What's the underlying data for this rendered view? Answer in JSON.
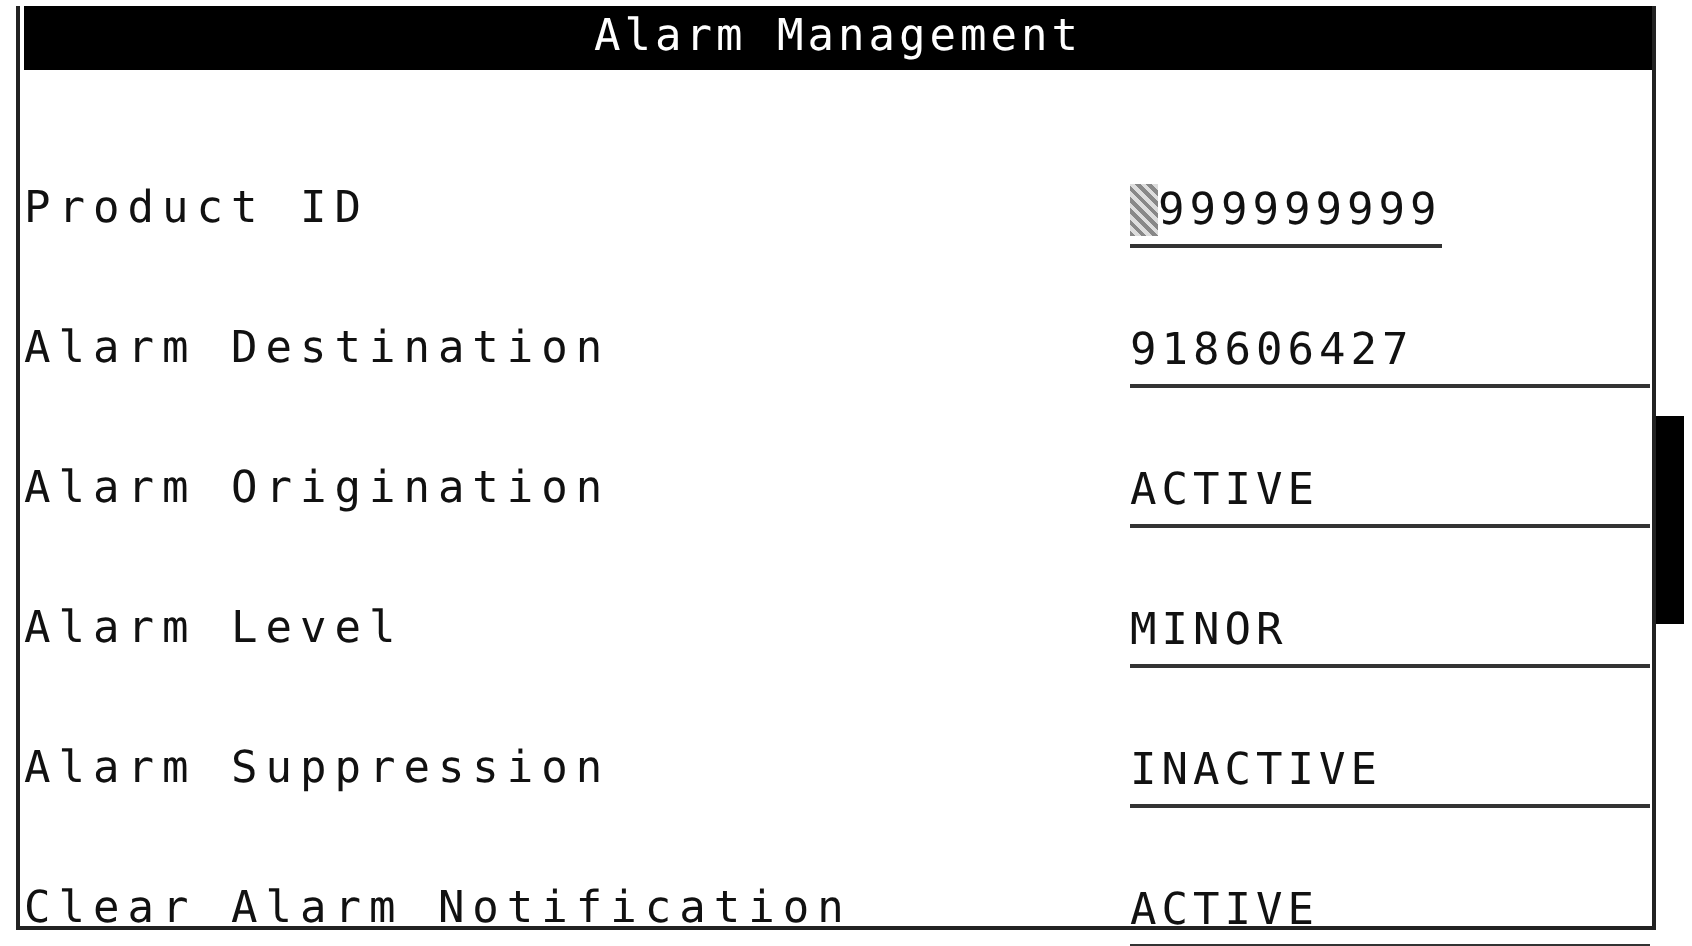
{
  "window": {
    "title": "Alarm Management"
  },
  "fields": [
    {
      "label": "Product ID",
      "value": "999999999",
      "focused": true
    },
    {
      "label": "Alarm Destination",
      "value": "918606427",
      "focused": false
    },
    {
      "label": "Alarm Origination",
      "value": "ACTIVE",
      "focused": false
    },
    {
      "label": "Alarm Level",
      "value": "MINOR",
      "focused": false
    },
    {
      "label": "Alarm Suppression",
      "value": "INACTIVE",
      "focused": false
    },
    {
      "label": "Clear Alarm Notification",
      "value": "ACTIVE",
      "focused": false
    }
  ]
}
